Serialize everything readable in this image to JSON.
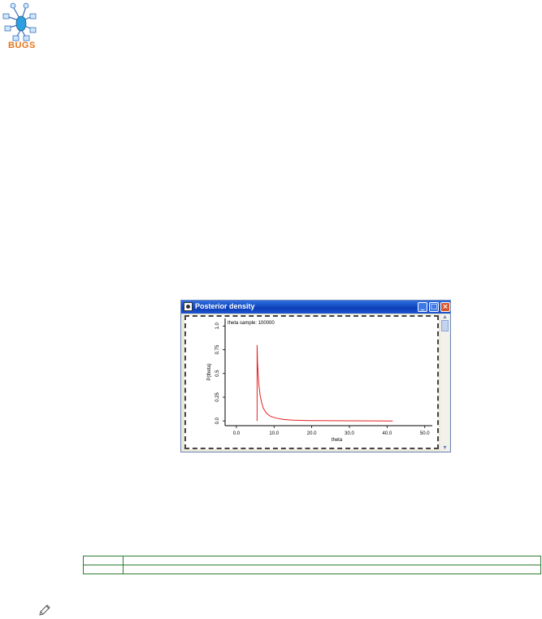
{
  "logo": {
    "text": "BUGS"
  },
  "window": {
    "title": "Posterior density",
    "buttons": {
      "minimize": "_",
      "maximize": "□",
      "close": "×"
    }
  },
  "chart_data": {
    "type": "line",
    "title": "theta sample: 100000",
    "xlabel": "theta",
    "ylabel": "P(theta)",
    "xlim": [
      -3,
      52
    ],
    "ylim": [
      -0.05,
      1.08
    ],
    "xticks": [
      "0.0",
      "10.0",
      "20.0",
      "30.0",
      "40.0",
      "50.0"
    ],
    "yticks": [
      "0.0",
      "0.25",
      "0.5",
      "0.75",
      "1.0"
    ],
    "series": [
      {
        "color": "#e52020",
        "x": [
          5.5,
          5.5,
          5.6,
          5.8,
          6.0,
          6.3,
          6.7,
          7.2,
          8.0,
          9.0,
          10.5,
          12.5,
          15.0,
          20.0,
          30.0,
          41.5
        ],
        "y": [
          0.0,
          0.8,
          0.62,
          0.48,
          0.37,
          0.27,
          0.19,
          0.13,
          0.08,
          0.05,
          0.03,
          0.015,
          0.008,
          0.003,
          0.001,
          0.0
        ]
      }
    ]
  },
  "table": {
    "rows": [
      [
        "",
        ""
      ],
      [
        "",
        ""
      ]
    ]
  }
}
